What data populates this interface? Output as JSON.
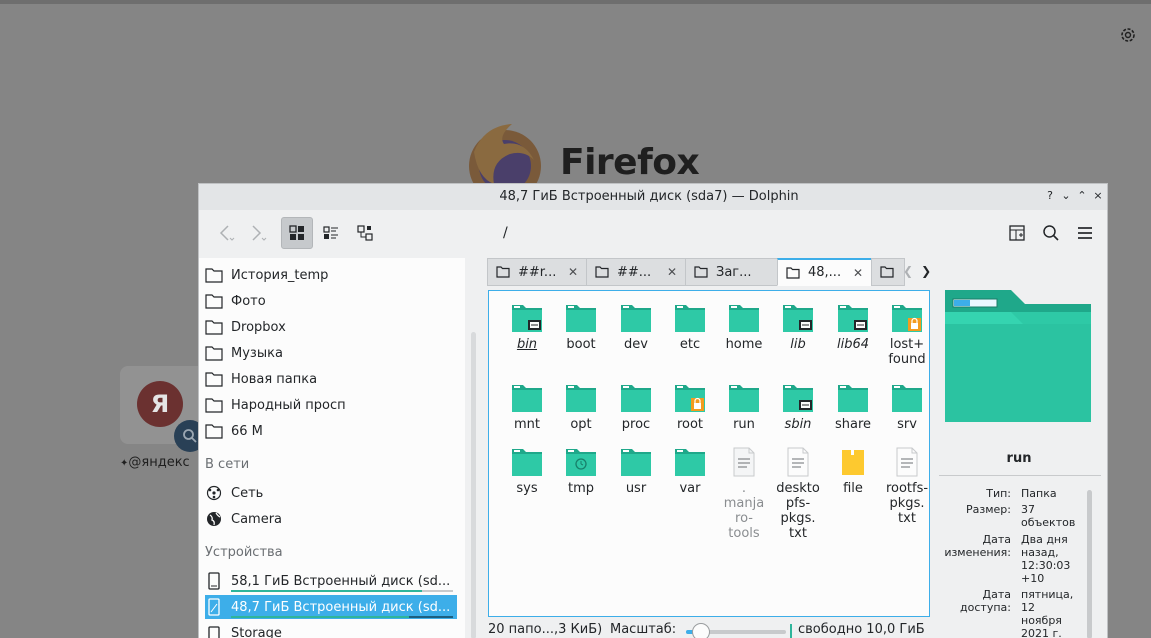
{
  "firefox": {
    "brand": "Firefox",
    "shortcut_letter": "Я",
    "shortcut_label": "@яндекс"
  },
  "window": {
    "title": "48,7 ГиБ Встроенный диск (sda7) — Dolphin",
    "controls": [
      "?",
      "⌄",
      "⌃",
      "×"
    ]
  },
  "toolbar": {
    "location": "/"
  },
  "places": {
    "items": [
      {
        "label": "История_temp"
      },
      {
        "label": "Фото"
      },
      {
        "label": "Dropbox"
      },
      {
        "label": "Музыка"
      },
      {
        "label": "Новая папка"
      },
      {
        "label": "Народный просп"
      },
      {
        "label": "66 М"
      }
    ],
    "network_header": "В сети",
    "network": [
      {
        "label": "Сеть"
      },
      {
        "label": "Camera"
      }
    ],
    "devices_header": "Устройства",
    "devices": [
      {
        "label": "58,1 ГиБ Встроенный диск (sd...",
        "usage": 0.86
      },
      {
        "label": "48,7 ГиБ Встроенный диск (sd...",
        "usage": 0.8
      },
      {
        "label": "Storage"
      }
    ]
  },
  "tabs": [
    {
      "label": "##r..."
    },
    {
      "label": "##..."
    },
    {
      "label": "Заг..."
    },
    {
      "label": "48,..."
    },
    {
      "label": ""
    }
  ],
  "files": [
    {
      "name": "bin",
      "type": "folder-link",
      "italic": true,
      "underline": true
    },
    {
      "name": "boot",
      "type": "folder"
    },
    {
      "name": "dev",
      "type": "folder"
    },
    {
      "name": "etc",
      "type": "folder"
    },
    {
      "name": "home",
      "type": "folder"
    },
    {
      "name": "lib",
      "type": "folder-link",
      "italic": true
    },
    {
      "name": "lib64",
      "type": "folder-link",
      "italic": true
    },
    {
      "name": "lost+\nfound",
      "type": "folder-locked"
    },
    {
      "name": "mnt",
      "type": "folder"
    },
    {
      "name": "opt",
      "type": "folder"
    },
    {
      "name": "proc",
      "type": "folder"
    },
    {
      "name": "root",
      "type": "folder-locked"
    },
    {
      "name": "run",
      "type": "folder"
    },
    {
      "name": "sbin",
      "type": "folder-link",
      "italic": true
    },
    {
      "name": "share",
      "type": "folder"
    },
    {
      "name": "srv",
      "type": "folder"
    },
    {
      "name": "sys",
      "type": "folder"
    },
    {
      "name": "tmp",
      "type": "folder-temp"
    },
    {
      "name": "usr",
      "type": "folder"
    },
    {
      "name": "var",
      "type": "folder"
    },
    {
      "name": ".\nmanja\nro-\ntools",
      "type": "file-hidden",
      "hidden": true
    },
    {
      "name": "deskto\npfs-\npkgs.\ntxt",
      "type": "file-text"
    },
    {
      "name": "file",
      "type": "file-yellow"
    },
    {
      "name": "rootfs-\npkgs.\ntxt",
      "type": "file-text"
    }
  ],
  "info": {
    "title": "run",
    "rows": [
      {
        "k": "Тип:",
        "v": "Папка"
      },
      {
        "k": "Размер:",
        "v": "37\nобъектов"
      },
      {
        "k": "Дата\nизменения:",
        "v": "Два дня\nназад,\n12:30:03\n+10"
      },
      {
        "k": "Дата\nдоступа:",
        "v": "пятница,\n12\nноября\n2021 г."
      }
    ]
  },
  "status": {
    "summary": "20 папо...,3 КиБ)",
    "zoom_label": "Масштаб:",
    "zoom_level": 0.15,
    "free": "свободно 10,0 ГиБ"
  },
  "colors": {
    "accent": "#3daee9",
    "folder": "#2fc9a6",
    "usage": "#2fb59b"
  }
}
